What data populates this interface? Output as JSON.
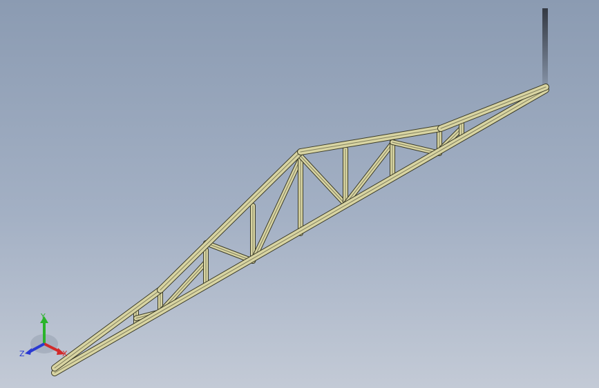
{
  "viewport": {
    "background_top": "#8b9bb2",
    "background_bottom": "#c3cad6"
  },
  "model": {
    "member_color": "#d8d4a2",
    "member_edge_color": "#3a3a26"
  },
  "triad": {
    "x_label": "X",
    "y_label": "Y",
    "z_label": "Z",
    "x_color": "#d22a2a",
    "y_color": "#2ab42a",
    "z_color": "#2a3ad2"
  }
}
